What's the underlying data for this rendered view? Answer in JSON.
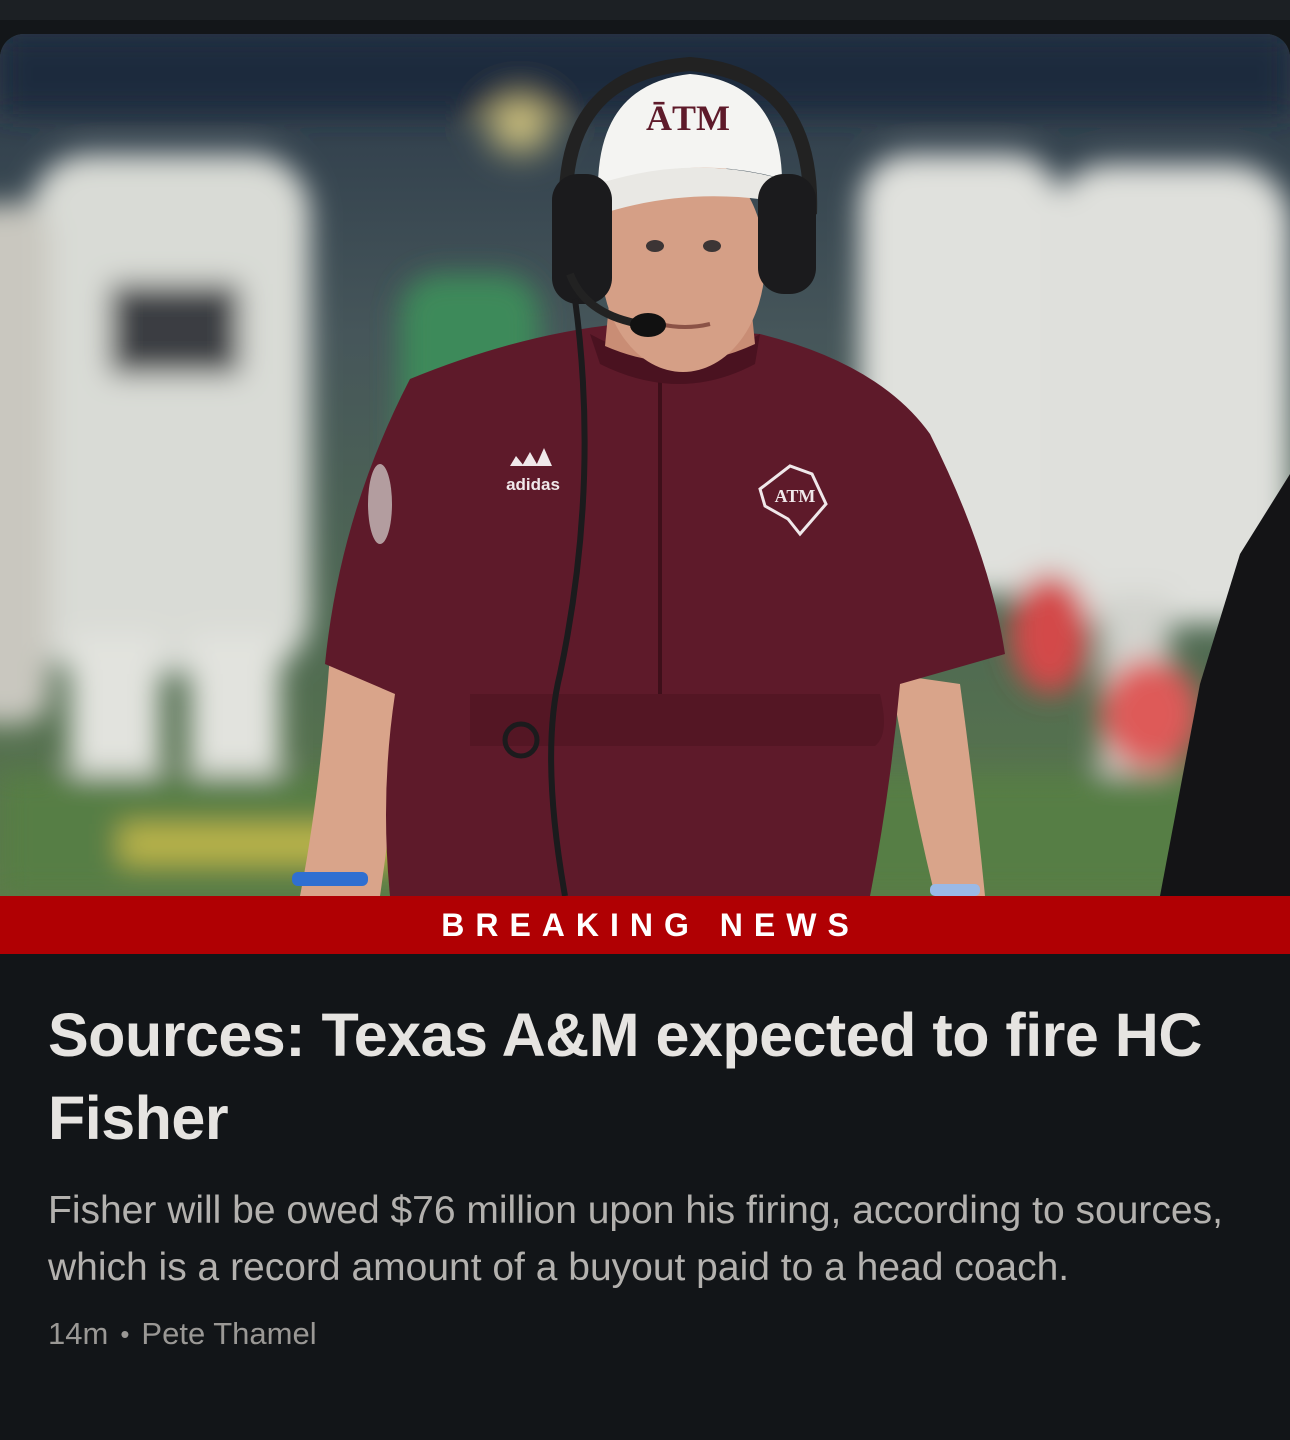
{
  "story": {
    "banner_label": "BREAKING NEWS",
    "headline": "Sources: Texas A&M expected to fire HC Fisher",
    "summary": "Fisher will be owed $76 million upon his firing, according to sources, which is a record amount of a buyout paid to a head coach.",
    "time_ago": "14m",
    "separator": "•",
    "author": "Pete Thamel"
  },
  "photo": {
    "hat_logo": "ĀTM",
    "shirt_brand": "adidas",
    "shirt_logo": "ATM"
  },
  "colors": {
    "banner_red": "#b00003",
    "background": "#121518",
    "headline_text": "#e6e4e1",
    "summary_text": "#b3b1ae",
    "maroon_shirt": "#5e1a2a"
  }
}
